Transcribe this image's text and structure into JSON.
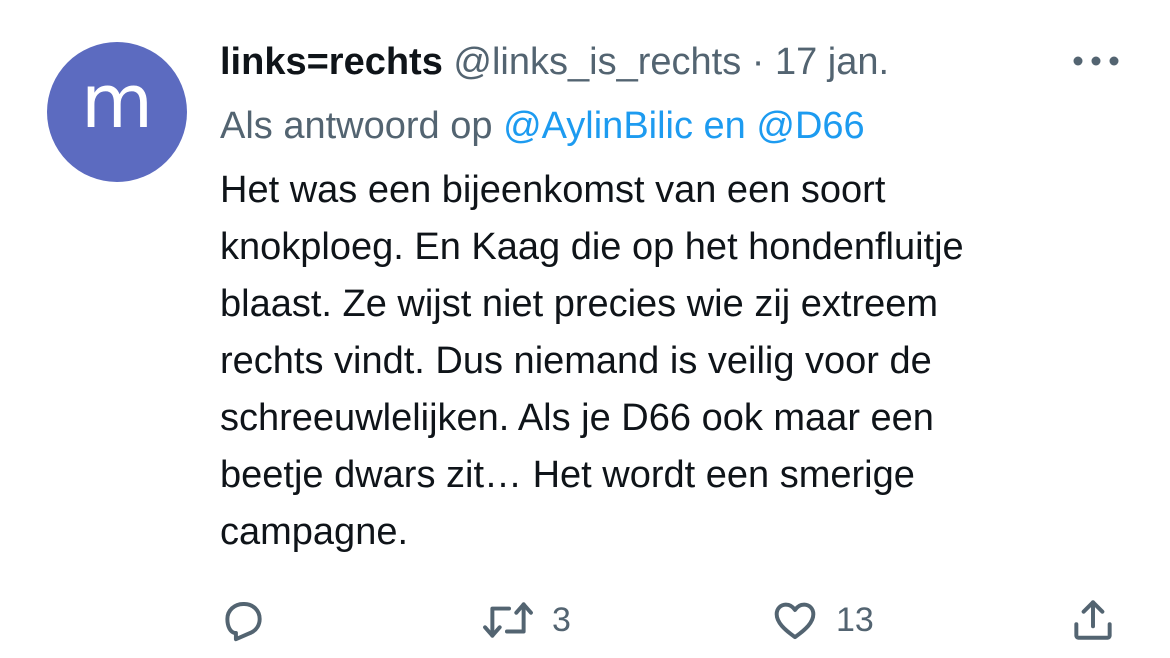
{
  "tweet": {
    "avatar_letter": "m",
    "avatar_color": "#5c6bc0",
    "display_name": "links=rechts",
    "handle": "@links_is_rechts",
    "separator": "·",
    "date": "17 jan.",
    "more_icon": "more-horizontal-icon",
    "reply_prefix": "Als antwoord op",
    "reply_mentions": "@AylinBilic en @D66",
    "text": "Het was een bijeenkomst van een soort\nknokploeg. En Kaag die op het hondenfluitje\nblaast. Ze wijst niet precies wie zij extreem\nrechts vindt. Dus niemand is veilig voor de\nschreeuwlelijken. Als je D66 ook maar een\nbeetje dwars zit… Het wordt een smerige\ncampagne."
  },
  "actions": {
    "reply": {
      "icon": "reply-icon",
      "count": ""
    },
    "retweet": {
      "icon": "retweet-icon",
      "count": "3"
    },
    "like": {
      "icon": "heart-icon",
      "count": "13"
    },
    "share": {
      "icon": "share-icon"
    }
  },
  "colors": {
    "text": "#0f1419",
    "secondary": "#536471",
    "link": "#1d9bf0"
  }
}
